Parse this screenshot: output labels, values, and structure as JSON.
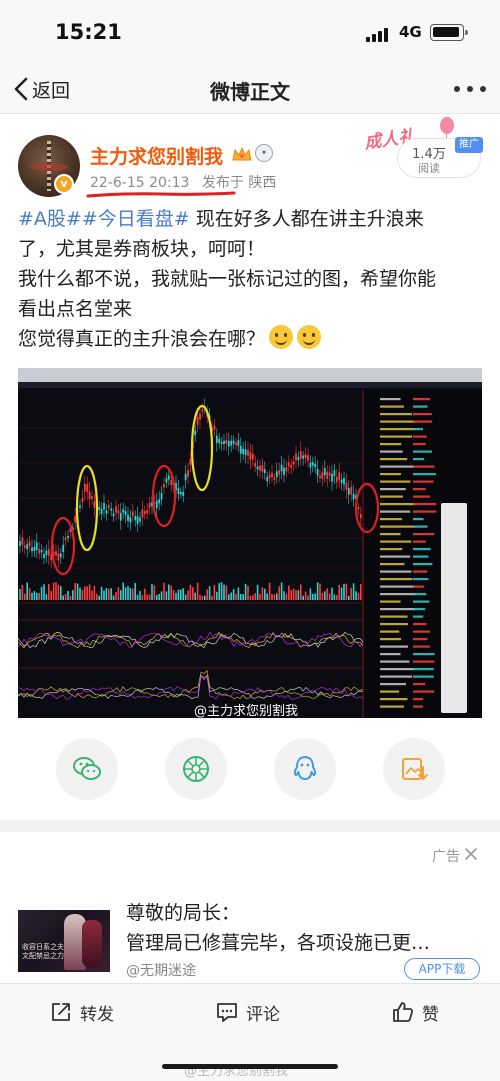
{
  "status_bar": {
    "time": "15:21",
    "network": "4G"
  },
  "nav": {
    "back_label": "返回",
    "title": "微博正文"
  },
  "post": {
    "author": "主力求您别割我",
    "date": "22-6-15 20:13",
    "location": "发布于 陕西",
    "views": "1.4万",
    "views_label": "阅读",
    "promo_badge": "推广",
    "banner_text": "成人礼",
    "tag1": "#A股#",
    "tag2": "#今日看盘#",
    "line1_text": "现在好多人都在讲主升浪来",
    "line2": "了，尤其是券商板块，呵呵！",
    "line3": "我什么都不说，我就贴一张标记过的图，希望你能",
    "line4": "看出点名堂来",
    "line5": "您觉得真正的主升浪会在哪？",
    "watermark": "@主力求您别割我"
  },
  "share": {
    "icons": [
      "wechat-icon",
      "moments-icon",
      "qq-icon",
      "save-image-icon"
    ]
  },
  "ad": {
    "label": "广告",
    "title": "尊敬的局长：",
    "description": "管理局已修葺完毕，各项设施已更…",
    "source": "@无期迷途",
    "download_label": "APP下载",
    "thumb_text": "收容日系之夫 文配禁忌之力"
  },
  "bottom": {
    "repost": "转发",
    "comment": "评论",
    "like": "赞",
    "watermark": "@主力求您别割我"
  },
  "colors": {
    "username": "#f05a0a",
    "hashtag": "#4a7bc9",
    "accent_blue": "#4f8ff7",
    "candle_up": "#ff3b3b",
    "candle_down": "#2fd0d0"
  }
}
